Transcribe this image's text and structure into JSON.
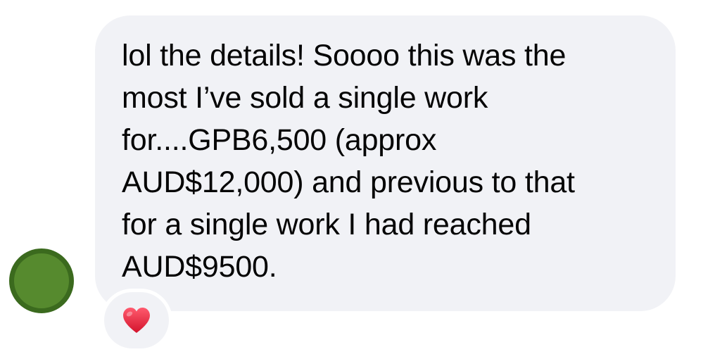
{
  "sender": {
    "avatar_icon": "avatar-circle-icon",
    "avatar_fill": "#568a2e",
    "avatar_ring": "#3b6a1e"
  },
  "message": {
    "text": "lol the details! Soooo this was the\nmost I’ve sold a single work\nfor....GPB6,500 (approx\nAUD$12,000) and previous to that\nfor a single work I had reached\nAUD$9500.",
    "bubble_color": "#f1f2f6"
  },
  "reaction": {
    "icon": "red-heart-icon",
    "color": "#e8243c"
  }
}
